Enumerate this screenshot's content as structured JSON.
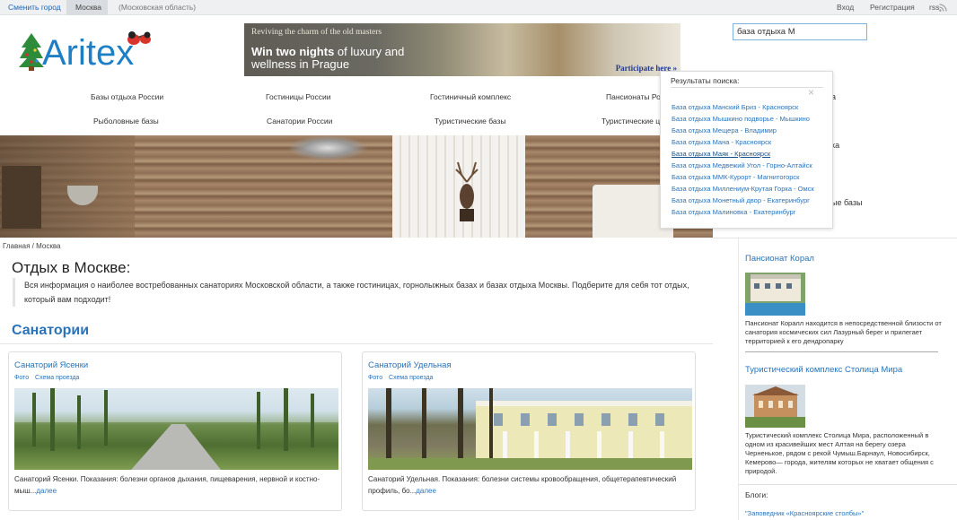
{
  "topbar": {
    "change_city": "Сменить город",
    "city": "Москва",
    "region": "(Московская область)",
    "login": "Вход",
    "register": "Регистрация",
    "rss": "rss"
  },
  "logo": {
    "text": "Aritex"
  },
  "banner": {
    "line1": "Reviving the charm of the old masters",
    "line2_part1": "Win two nights",
    "line2_part2": " of luxury and wellness in Prague",
    "cta": "Participate here »"
  },
  "search": {
    "value": "база отдыха М"
  },
  "nav": {
    "row1": [
      "Базы отдыха России",
      "Гостиницы России",
      "Гостиничный комплекс",
      "Пансионаты Росс"
    ],
    "row2": [
      "Рыболовные базы",
      "Санатории России",
      "Туристические базы",
      "Туристические цен"
    ]
  },
  "peek": {
    "a": "а",
    "b": "ка",
    "c": "ые базы"
  },
  "search_popup": {
    "title": "Результаты поиска:",
    "close": "×",
    "results": [
      "База отдыха Манский Бриз - Красноярск",
      "База отдыха Мышкино подворье - Мышкино",
      "База отдыха Мещера - Владимир",
      "База отдыха Мана - Красноярск",
      "База отдыха Маяк - Красноярск",
      "База отдыха Медвежий Угол - Горно-Алтайск",
      "База отдыха ММК-Курорт - Магнитогорск",
      "База отдыха Миллениум-Крутая Горка - Омск",
      "База отдыха Монетный двор - Екатеринбург",
      "База отдыха Малиновка - Екатеринбург"
    ]
  },
  "breadcrumb": "Главная / Москва",
  "page_title": "Отдых в Москве:",
  "intro": "Вся информация о наиболее востребованных санаториях Московской области, а также гостиницах, горнолыжных базах и базах отдыха Москвы. Подберите для себя тот отдых, который вам подходит!",
  "section_title": "Санатории",
  "cards": [
    {
      "title": "Санаторий Ясенки",
      "link_photo": "Фото",
      "link_map": "Схема проезда",
      "desc": " Санаторий Ясенки. Показания: болезни органов дыхания, пищеварения, нервной и костно-мыш...",
      "more": "далее"
    },
    {
      "title": "Санаторий Удельная",
      "link_photo": "Фото",
      "link_map": "Схема проезда",
      "desc": "Санаторий Удельная. Показания: болезни системы кровообращения, общетерапевтический профиль, бо...",
      "more": "далее"
    }
  ],
  "sidebar": {
    "items": [
      {
        "title": "Пансионат Корал",
        "desc": "Пансионат Коралл находится в непосредственной близости от санатория космических сил Лазурный берег и прилегает территорией к его дендропарку"
      },
      {
        "title": "Туристический комплекс Столица Мира",
        "desc": "Туристический комплекс Столица Мира, расположенный в одном из красивейших мест Алтая на берегу озера Черненькое, рядом с рекой Чумыш.Барнаул, Новосибирск, Кемерово— города, жителям которых не хватает общения с природой."
      }
    ],
    "blogs_label": "Блоги:",
    "blog_link": "\"Заповедник «Красноярские столбы»\""
  }
}
